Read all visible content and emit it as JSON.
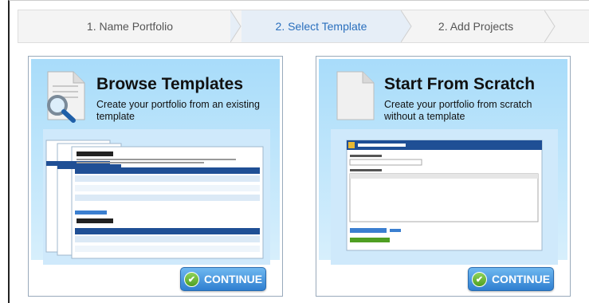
{
  "steps": [
    {
      "label": "1. Name Portfolio"
    },
    {
      "label": "2. Select Template"
    },
    {
      "label": "2. Add Projects"
    }
  ],
  "browse": {
    "title": "Browse Templates",
    "description": "Create your portfolio from an existing template",
    "continue_label": "CONTINUE"
  },
  "scratch": {
    "title": "Start From Scratch",
    "description": "Create your portfolio from scratch without a template",
    "continue_label": "CONTINUE"
  },
  "colors": {
    "accent": "#2a6fbd",
    "continue_button": "#3d8fe0",
    "card_bg": "#a8dcfa"
  }
}
